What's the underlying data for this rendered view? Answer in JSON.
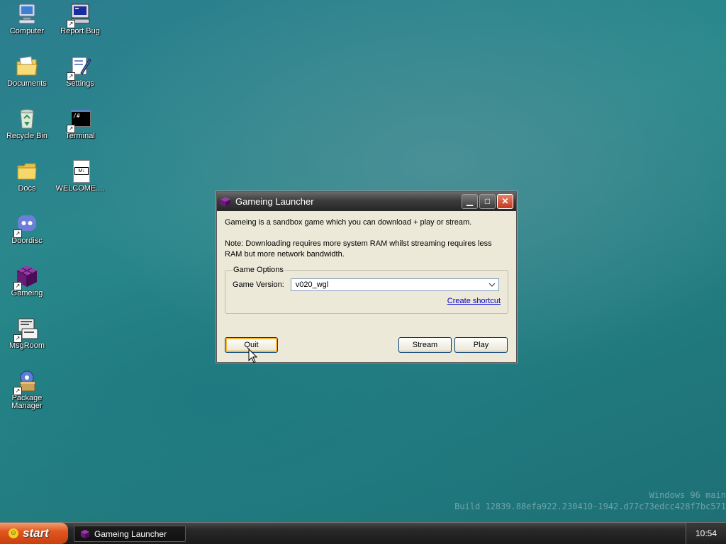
{
  "desktop": {
    "icons": [
      {
        "label": "Computer"
      },
      {
        "label": "Report Bug"
      },
      {
        "label": "Documents"
      },
      {
        "label": "Settings"
      },
      {
        "label": "Recycle Bin"
      },
      {
        "label": "Terminal"
      },
      {
        "label": "Docs"
      },
      {
        "label": "WELCOME...."
      },
      {
        "label": "Doordisc"
      },
      {
        "label": "Gameing"
      },
      {
        "label": "MsgRoom"
      },
      {
        "label": "Package Manager"
      }
    ],
    "terminal_glyph": "/#",
    "welcome_glyph": "M↓"
  },
  "window": {
    "title": "Gameing Launcher",
    "description": "Gameing is a sandbox game which you can download + play or stream.",
    "note": "Note: Downloading requires more system RAM whilst streaming requires less RAM but more network bandwidth.",
    "group_label": "Game Options",
    "version_label": "Game Version:",
    "version_value": "v020_wgl",
    "create_shortcut": "Create shortcut",
    "quit_label": "Quit",
    "stream_label": "Stream",
    "play_label": "Play",
    "controls": {
      "minimize": "▁",
      "maximize": "□",
      "close": "✕"
    }
  },
  "taskbar": {
    "start_label": "start",
    "task_label": "Gameing Launcher",
    "clock": "10:54"
  },
  "watermark": {
    "line1": "Windows 96 main",
    "line2": "Build 12839.88efa922.230410-1942.d77c73edcc428f7bc571"
  },
  "colors": {
    "accent": "#e2561f",
    "gameing_purple": "#6a1b7a"
  }
}
